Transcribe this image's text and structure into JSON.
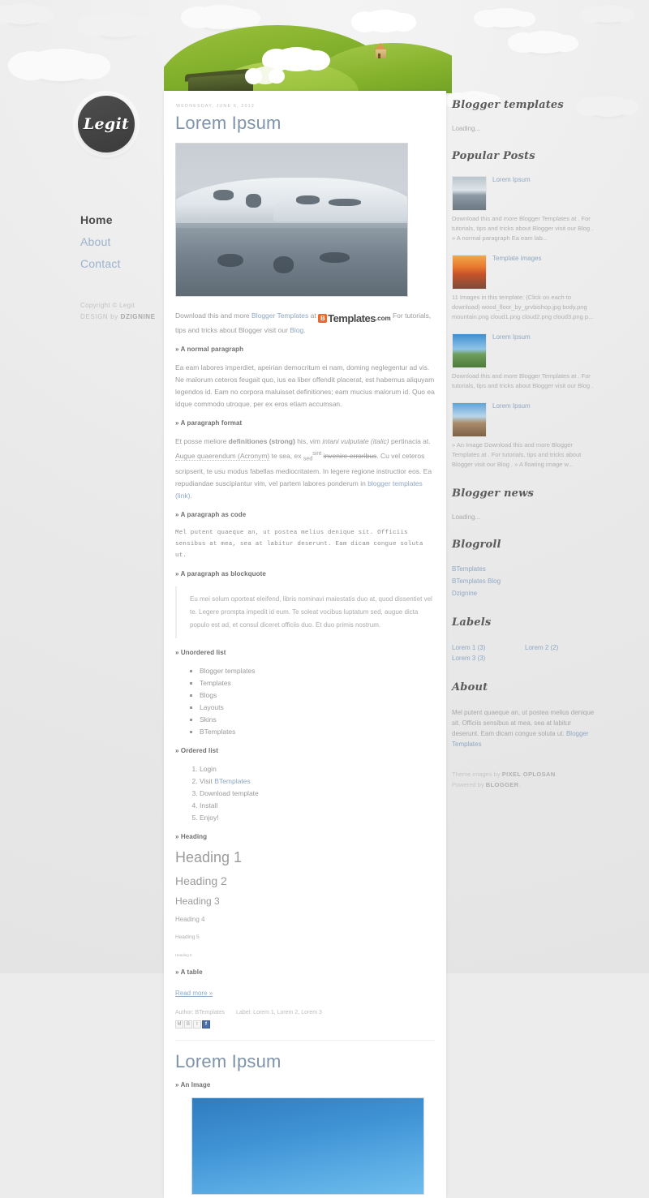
{
  "site": {
    "logo_text": "Legit",
    "nav": [
      {
        "label": "Home",
        "current": true
      },
      {
        "label": "About",
        "current": false
      },
      {
        "label": "Contact",
        "current": false
      }
    ],
    "copyright": "Copyright © Legit",
    "design_prefix": "DESIGN",
    "design_by": "by",
    "design_credit": "DZIGNINE"
  },
  "posts": [
    {
      "date": "WEDNESDAY, JUNE 6, 2012",
      "title": "Lorem Ipsum",
      "intro_before": "Download this and more ",
      "intro_link1": "Blogger Templates",
      "intro_mid": " at ",
      "brand_mark": "B",
      "brand_name": "Templates",
      "brand_tld": ".com",
      "intro_after": " For tutorials, tips and tricks about Blogger visit our ",
      "intro_link2": "Blog",
      "intro_end": ".",
      "h_normal": "» A normal paragraph",
      "normal_text": "Ea eam labores imperdiet, apeirian democritum ei nam, doming neglegentur ad vis. Ne malorum ceteros feugait quo, ius ea liber offendit placerat, est habemus aliquyam legendos id. Eam no corpora maluisset definitiones; eam mucius malorum id. Quo ea idque commodo utroque, per ex eros etiam accumsan.",
      "h_format": "» A paragraph format",
      "fmt_1": "Et posse meliore ",
      "fmt_strong": "definitiones (strong)",
      "fmt_2": " his, vim ",
      "fmt_italic": "intani vulputate (italic)",
      "fmt_3": " pertinacia at. ",
      "fmt_acronym": "Augue quaerendum (Acronym)",
      "fmt_4": " te sea, ex ",
      "fmt_sub": "sed",
      "fmt_sup": "sint",
      "fmt_strike": "invenire erroribus",
      "fmt_5": ". Cu vel ceteros scripserit, te usu modus fabellas mediocritatem. In legere regione instructior eos. Ea repudiandae suscipiantur vim, vel partem labores ponderum in ",
      "fmt_link": "blogger templates (link)",
      "fmt_6": ".",
      "h_code": "» A paragraph as code",
      "code_text": "Mel putent quaeque an, ut postea melius denique sit. Officiis sensibus at mea, sea at labitur deserunt. Eam dicam congue soluta ut.",
      "h_quote": "» A paragraph as blockquote",
      "quote_text": "Eu mei solum oporteat eleifend, libris nominavi maiestatis duo at, quod dissentiet vel te. Legere prompta impedit id eum. Te soleat vocibus luptatum sed, augue dicta populo est ad, et consul diceret officiis duo. Et duo primis nostrum.",
      "h_ul": "» Unordered list",
      "ul_items": [
        "Blogger templates",
        "Templates",
        "Blogs",
        "Layouts",
        "Skins",
        "BTemplates"
      ],
      "h_ol": "» Ordered list",
      "ol_items": [
        "Login",
        "Visit BTemplates",
        "Download template",
        "Install",
        "Enjoy!"
      ],
      "ol_link_index": 1,
      "ol_link_prefix": "Visit ",
      "ol_link_text": "BTemplates",
      "h_heading": "» Heading",
      "heading1": "Heading 1",
      "heading2": "Heading 2",
      "heading3": "Heading 3",
      "heading4": "Heading 4",
      "heading5": "Heading 5",
      "heading6": "Heading 6",
      "h_table": "» A table",
      "read_more": "Read more »",
      "author": "Author: BTemplates",
      "labels": "Label: Lorem 1, Lorem 2, Lorem 3",
      "share": [
        "M",
        "B",
        "t",
        "f"
      ]
    },
    {
      "title": "Lorem Ipsum",
      "h_image": "» An Image"
    }
  ],
  "sidebar": {
    "widgets": [
      {
        "title": "Blogger templates",
        "loading": "Loading..."
      },
      {
        "title": "Popular Posts",
        "items": [
          {
            "title": "Lorem Ipsum",
            "snippet": "Download this and more Blogger Templates at . For tutorials, tips and tricks about Blogger visit our Blog . » A normal paragraph Ea eam lab..."
          },
          {
            "title": "Template images",
            "snippet": "11 Images in this template: (Click on each to download) wood_floor_by_grvbishop.jpg body.png mountain.png cloud1.png cloud2.png cloud3.png p..."
          },
          {
            "title": "Lorem Ipsum",
            "snippet": "Download this and more Blogger Templates at . For tutorials, tips and tricks about Blogger visit our Blog ."
          },
          {
            "title": "Lorem Ipsum",
            "snippet": "» An Image Download this and more Blogger Templates at . For tutorials, tips and tricks about Blogger visit our Blog . » A floating image w..."
          }
        ]
      },
      {
        "title": "Blogger news",
        "loading": "Loading..."
      },
      {
        "title": "Blogroll",
        "links": [
          "BTemplates",
          "BTemplates Blog",
          "Dzignine"
        ]
      },
      {
        "title": "Labels",
        "labels": [
          "Lorem 1 (3)",
          "Lorem 2 (2)",
          "Lorem 3 (3)"
        ]
      },
      {
        "title": "About",
        "text_before": "Mel putent quaeque an, ut postea melius denique sit. Officiis sensibus at mea, sea at labitur deserunt. Eam dicam congue soluta ut. ",
        "link": "Blogger Templates"
      }
    ],
    "credits_1_pre": "Theme images by ",
    "credits_1_b": "PIXEL OPLOSAN",
    "credits_1_post": ".",
    "credits_2_pre": "Powered by ",
    "credits_2_b": "BLOGGER",
    "credits_2_post": "."
  },
  "colors": {
    "link": "#8fa8c4",
    "title": "#7f93ab",
    "brand_orange": "#f26522",
    "hill_green": "#8fb82e",
    "facebook": "#4a6ea9"
  }
}
